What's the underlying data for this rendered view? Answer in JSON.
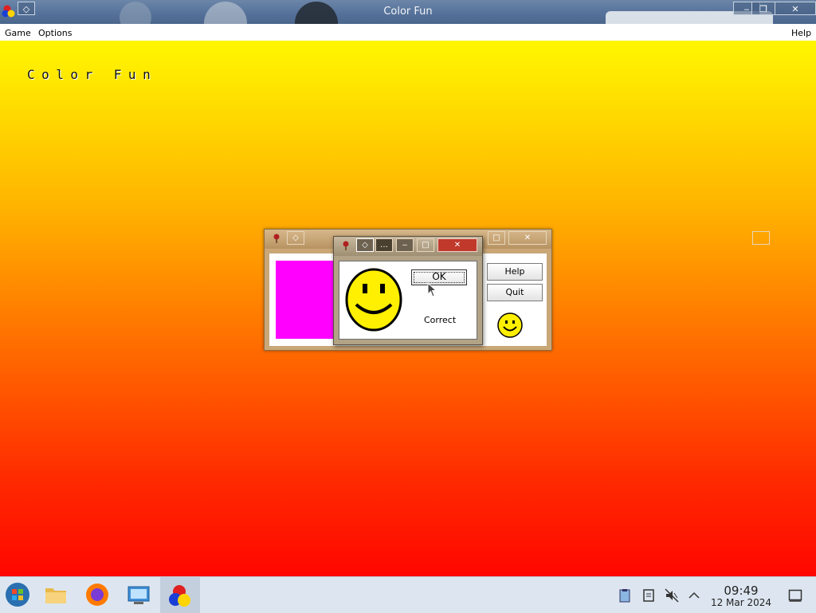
{
  "window": {
    "title": "Color Fun"
  },
  "menu": {
    "game": "Game",
    "options": "Options",
    "help": "Help"
  },
  "game": {
    "title": "Color Fun",
    "swatch_color": "#ff00ff"
  },
  "back_dialog": {
    "help_label": "Help",
    "quit_label": "Quit"
  },
  "front_dialog": {
    "ok_label": "OK",
    "message": "Correct"
  },
  "taskbar": {
    "apps": [
      "start-menu-icon",
      "file-manager-icon",
      "firefox-icon",
      "network-settings-icon",
      "color-fun-icon"
    ],
    "tray_icons": [
      "clipboard-icon",
      "notes-icon",
      "volume-muted-icon",
      "chevron-up-icon"
    ],
    "time": "09:49",
    "date": "12 Mar 2024"
  },
  "colors": {
    "gradient_top": "#fff700",
    "gradient_bottom": "#ff0600",
    "smiley_yellow": "#ffef00"
  }
}
